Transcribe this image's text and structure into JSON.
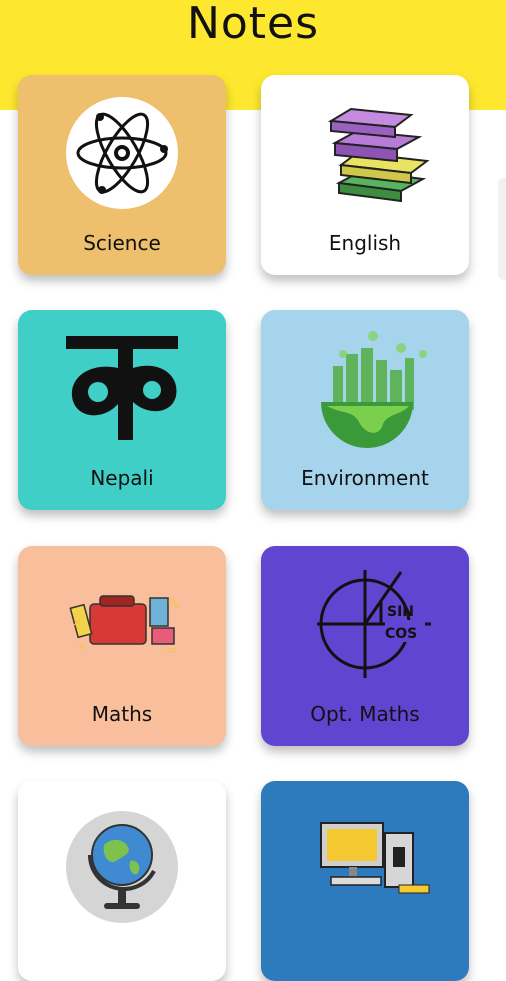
{
  "page": {
    "title": "Notes"
  },
  "colors": {
    "header": "#fde82f",
    "science": "#eebf6c",
    "english": "#ffffff",
    "nepali": "#3fcfc7",
    "environment": "#a6d4ec",
    "maths": "#f9be9b",
    "opt_maths": "#5f45cf",
    "geography": "#ffffff",
    "computer": "#2d7bbd"
  },
  "subjects": [
    {
      "label": "Science",
      "icon": "atom-icon"
    },
    {
      "label": "English",
      "icon": "books-stack-icon"
    },
    {
      "label": "Nepali",
      "icon": "devanagari-ka-icon"
    },
    {
      "label": "Environment",
      "icon": "earth-city-icon"
    },
    {
      "label": "Maths",
      "icon": "school-supplies-icon"
    },
    {
      "label": "Opt. Maths",
      "icon": "sin-cos-graph-icon"
    },
    {
      "label": "",
      "icon": "globe-icon"
    },
    {
      "label": "",
      "icon": "computer-icon"
    }
  ]
}
